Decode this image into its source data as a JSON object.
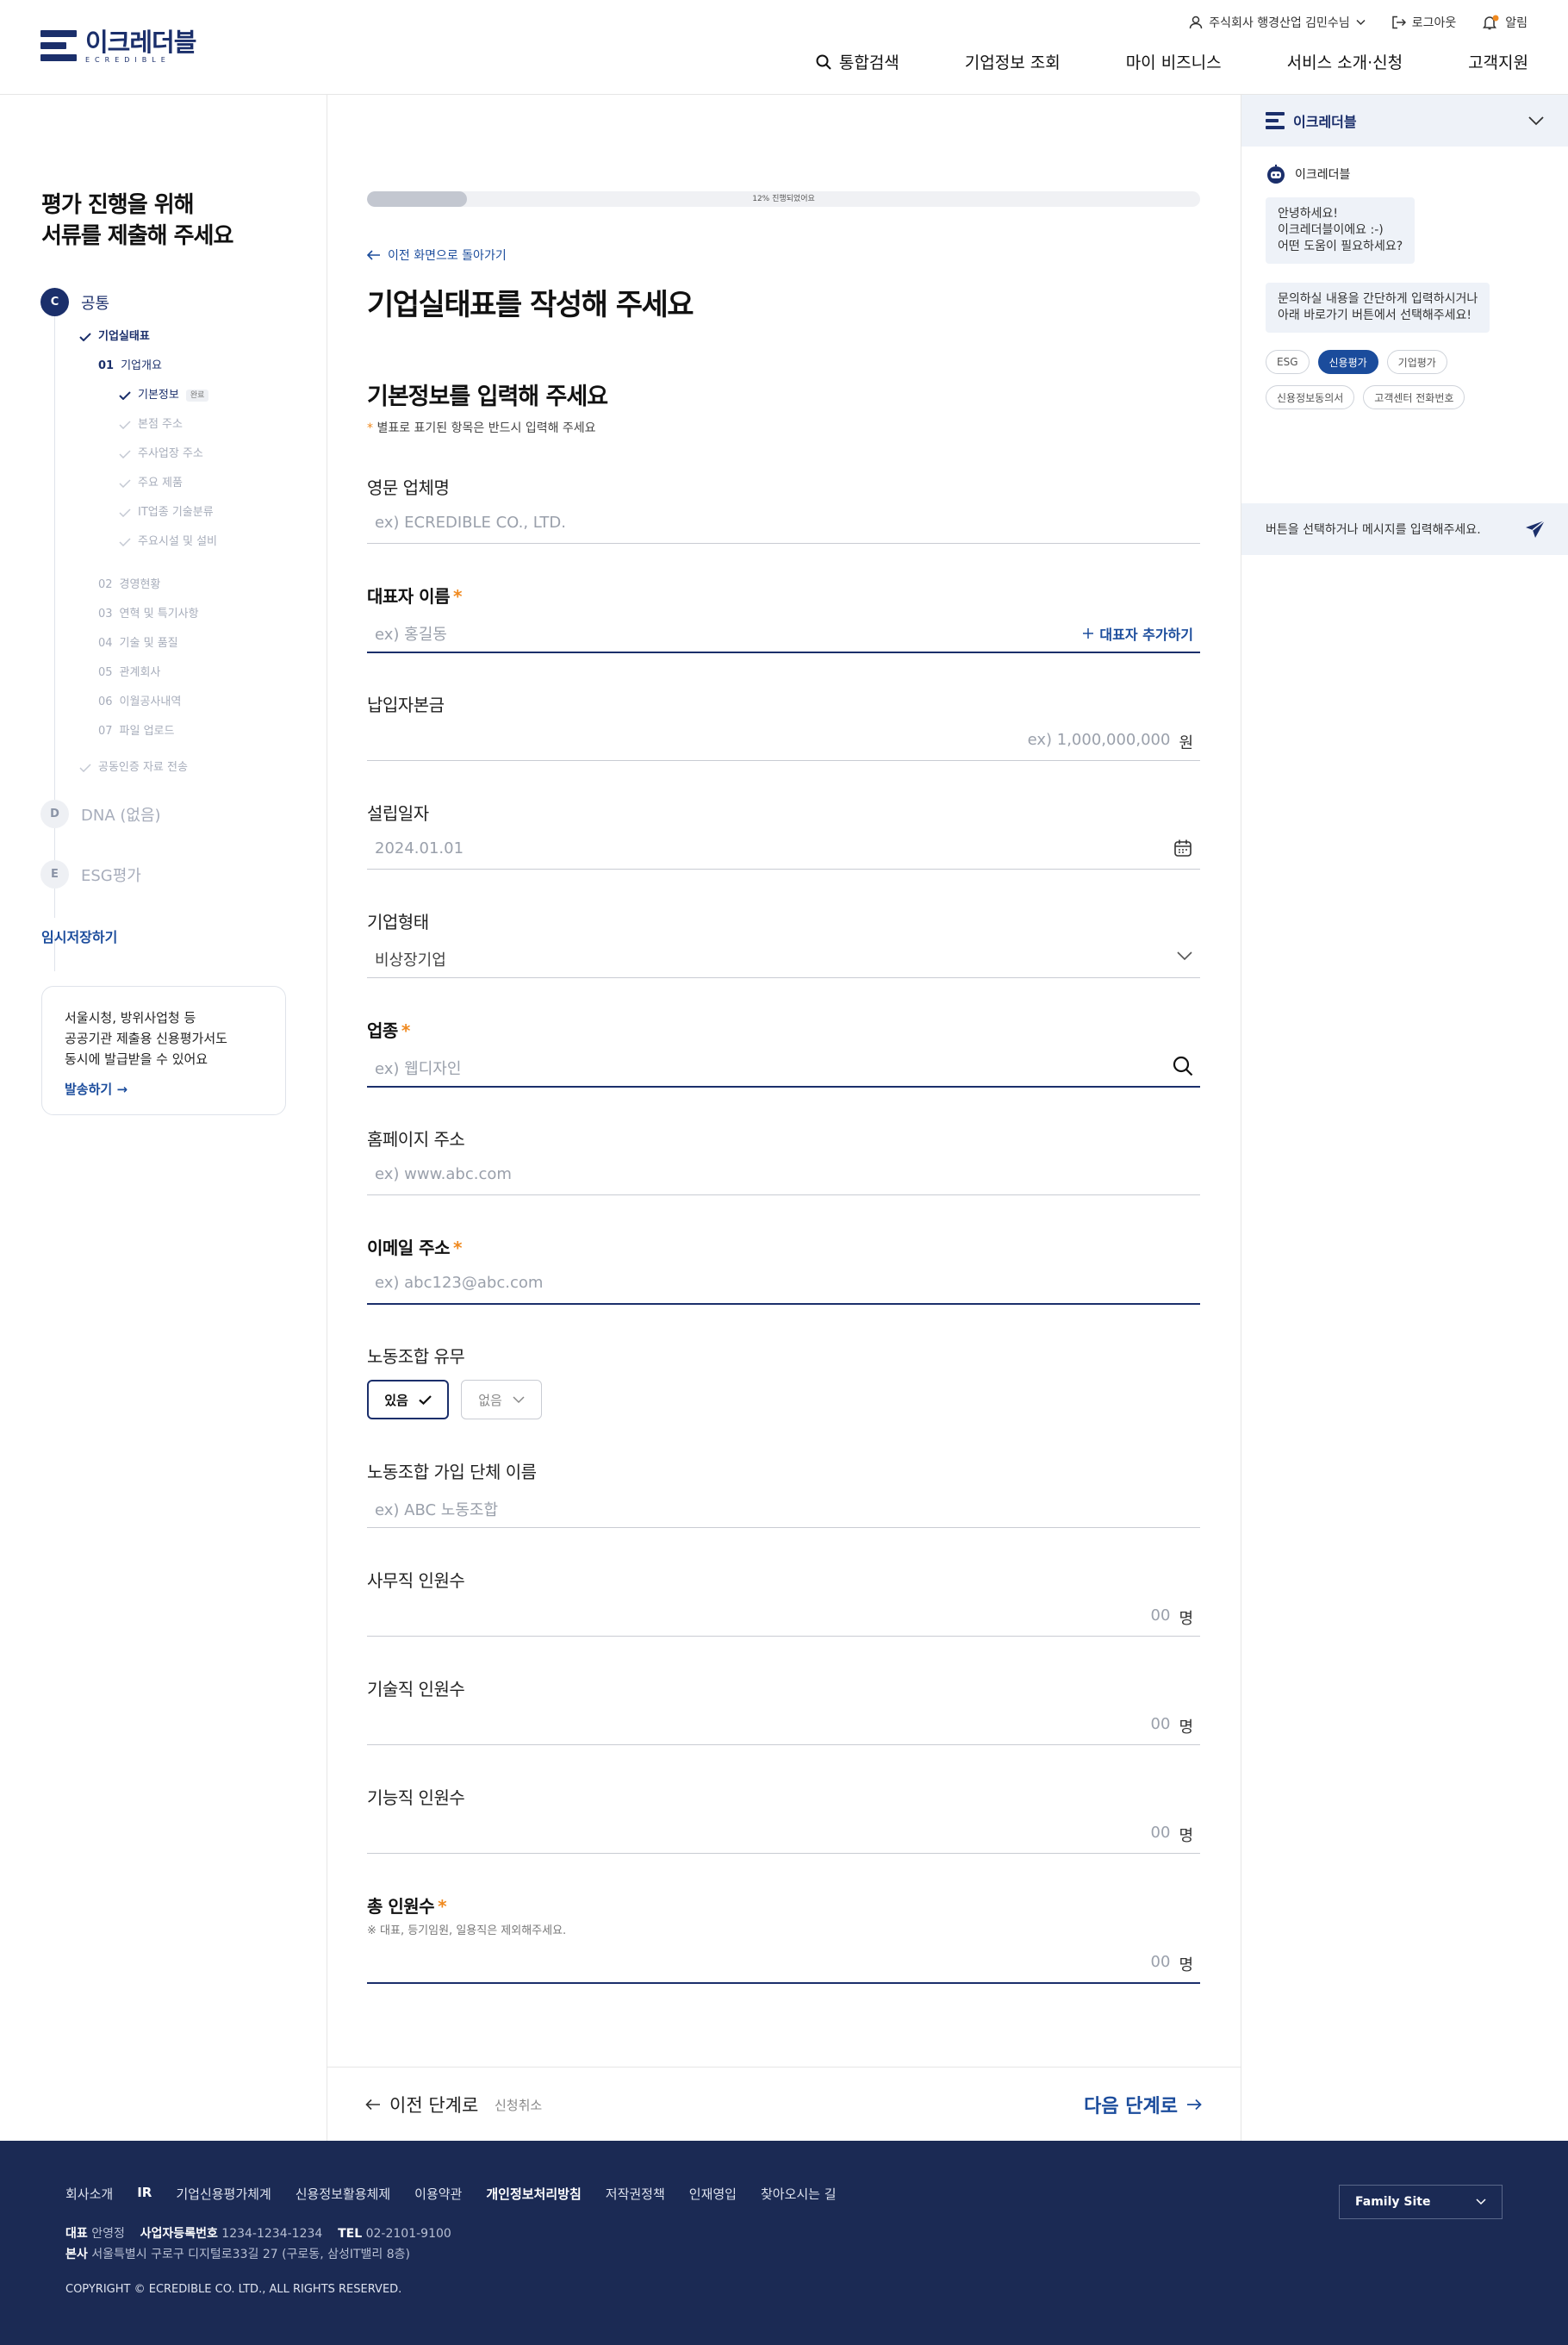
{
  "header": {
    "logo_name": "이크레더블",
    "logo_sub": "ECREDIBLE",
    "user": "주식회사 행경산업 김민수님",
    "logout": "로그아웃",
    "alarm": "알림",
    "nav": [
      "통합검색",
      "기업정보 조회",
      "마이 비즈니스",
      "서비스 소개·신청",
      "고객지원"
    ]
  },
  "sidebar": {
    "title_line1": "평가 진행을 위해",
    "title_line2": "서류를 제출해 주세요",
    "step_c": {
      "badge": "C",
      "label": "공통"
    },
    "tree": {
      "l1": "기업실태표",
      "l2_num": "01",
      "l2": "기업개요",
      "items": [
        "기본정보",
        "본점 주소",
        "주사업장 주소",
        "주요 제품",
        "IT업종 기술분류",
        "주요시설 및 설비"
      ],
      "item0_tag": "완료",
      "sections": [
        {
          "num": "02",
          "label": "경영현황"
        },
        {
          "num": "03",
          "label": "연혁 및 특기사항"
        },
        {
          "num": "04",
          "label": "기술 및 품질"
        },
        {
          "num": "05",
          "label": "관계회사"
        },
        {
          "num": "06",
          "label": "이월공사내역"
        },
        {
          "num": "07",
          "label": "파일 업로드"
        }
      ],
      "cert": "공동인증 자료 전송"
    },
    "step_d": {
      "badge": "D",
      "label": "DNA (없음)"
    },
    "step_e": {
      "badge": "E",
      "label": "ESG평가"
    },
    "save_link": "임시저장하기",
    "promo": {
      "l1": "서울시청, 방위사업청 등",
      "l2": "공공기관 제출용 신용평가서도",
      "l3": "동시에 발급받을 수 있어요",
      "link": "발송하기"
    }
  },
  "main": {
    "progress": {
      "percent": 12,
      "label": "12% 진행되었어요"
    },
    "back_link": "이전 화면으로 돌아가기",
    "title": "기업실태표를 작성해 주세요",
    "section_title": "기본정보를 입력해 주세요",
    "required_note_star": "*",
    "required_note": "별표로 표기된 항목은 반드시 입력해 주세요",
    "fields": {
      "eng_name": {
        "label": "영문 업체명",
        "placeholder": "ex) ECREDIBLE CO., LTD."
      },
      "ceo": {
        "label": "대표자 이름",
        "placeholder": "ex) 홍길동",
        "add": "대표자 추가하기"
      },
      "capital": {
        "label": "납입자본금",
        "placeholder": "ex) 1,000,000,000",
        "unit": "원"
      },
      "founded": {
        "label": "설립일자",
        "placeholder": "2024.01.01"
      },
      "company_type": {
        "label": "기업형태",
        "value": "비상장기업"
      },
      "industry": {
        "label": "업종",
        "placeholder": "ex) 웹디자인"
      },
      "homepage": {
        "label": "홈페이지 주소",
        "placeholder": "ex) www.abc.com"
      },
      "email": {
        "label": "이메일 주소",
        "placeholder": "ex) abc123@abc.com"
      },
      "union": {
        "label": "노동조합 유무",
        "yes": "있음",
        "no": "없음"
      },
      "union_name": {
        "label": "노동조합 가입 단체 이름",
        "placeholder": "ex) ABC 노동조합"
      },
      "office": {
        "label": "사무직 인원수",
        "placeholder": "00",
        "unit": "명"
      },
      "tech": {
        "label": "기술직 인원수",
        "placeholder": "00",
        "unit": "명"
      },
      "skill": {
        "label": "기능직 인원수",
        "placeholder": "00",
        "unit": "명"
      },
      "total": {
        "label": "총 인원수",
        "note": "※ 대표, 등기임원, 일용직은 제외해주세요.",
        "placeholder": "00",
        "unit": "명"
      }
    },
    "prev": "이전 단계로",
    "cancel": "신청취소",
    "next": "다음 단계로"
  },
  "chat": {
    "brand": "이크레더블",
    "bot_name": "이크레더블",
    "msg1": [
      "안녕하세요!",
      "이크레더블이에요 :-)",
      "어떤 도움이 필요하세요?"
    ],
    "msg2": [
      "문의하실 내용을 간단하게 입력하시거나",
      "아래 바로가기 버튼에서 선택해주세요!"
    ],
    "chips": [
      "ESG",
      "신용평가",
      "기업평가",
      "신용정보동의서",
      "고객센터 전화번호"
    ],
    "input_placeholder": "버튼을 선택하거나 메시지를 입력해주세요."
  },
  "footer": {
    "links": [
      "회사소개",
      "IR",
      "기업신용평가체계",
      "신용정보활용체제",
      "이용약관",
      "개인정보처리방침",
      "저작권정책",
      "인재영입",
      "찾아오시는 길"
    ],
    "ceo_label": "대표",
    "ceo": "안영정",
    "biz_label": "사업자등록번호",
    "biz": "1234-1234-1234",
    "tel_label": "TEL",
    "tel": "02-2101-9100",
    "addr_label": "본사",
    "addr": "서울특별시 구로구 디지털로33길 27 (구로동, 삼성IT밸리 8층)",
    "copyright": "COPYRIGHT © ECREDIBLE CO. LTD., ALL RIGHTS RESERVED.",
    "family": "Family Site"
  },
  "colors": {
    "primary": "#1b2f6b",
    "accent": "#1b4c9c",
    "required": "#f08a20",
    "footer": "#1b2a54"
  }
}
